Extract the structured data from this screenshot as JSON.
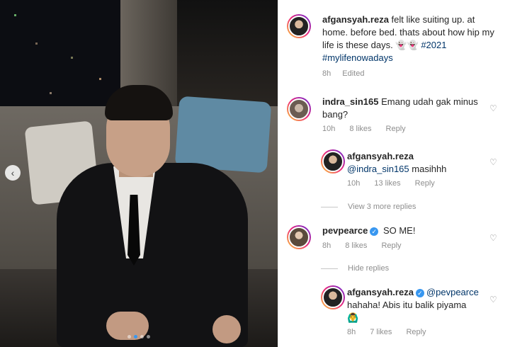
{
  "post": {
    "username": "afgansyah.reza",
    "caption": " felt like suiting up. at home. before bed. thats about how hip my life is these days. 👻👻 ",
    "hashtag1": "#2021",
    "hashtag2": "#mylifenowadays",
    "time": "8h",
    "edited": "Edited"
  },
  "carousel": {
    "prev_icon": "chevron-left-icon",
    "dots": 4,
    "active_dot": 1
  },
  "comments": [
    {
      "username": "indra_sin165",
      "text": " Emang udah gak minus bang?",
      "time": "10h",
      "likes": "8 likes",
      "reply": "Reply"
    },
    {
      "username": "afgansyah.reza",
      "mention": "@indra_sin165",
      "text": " masihhh",
      "time": "10h",
      "likes": "13 likes",
      "reply": "Reply"
    },
    {
      "view_more": "View 3 more replies"
    },
    {
      "username": "pevpearce",
      "text": " SO ME!",
      "time": "8h",
      "likes": "8 likes",
      "reply": "Reply"
    },
    {
      "hide_replies": "Hide replies"
    },
    {
      "username": "afgansyah.reza",
      "mention": "@pevpearce",
      "text": "hahaha! Abis itu balik piyama",
      "emoji": "🙆‍♂️",
      "time": "8h",
      "likes": "7 likes",
      "reply": "Reply"
    }
  ],
  "icons": {
    "heart": "heart-icon",
    "verified": "verified-badge-icon"
  },
  "colors": {
    "link": "#003569",
    "verified": "#3897f0",
    "muted": "#8e8e8e"
  }
}
